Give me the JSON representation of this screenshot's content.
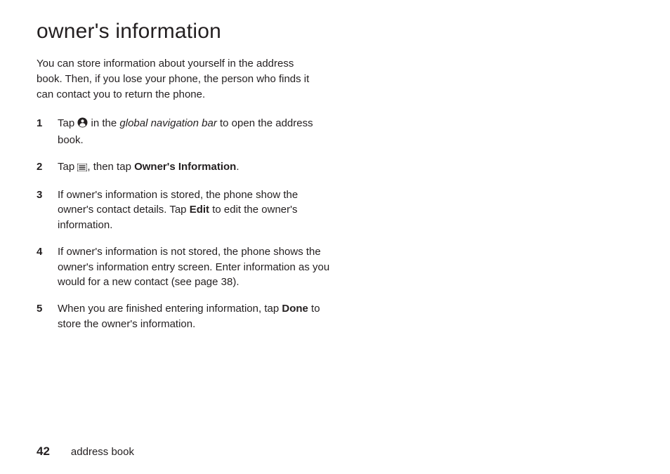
{
  "title": "owner's information",
  "intro": "You can store information about yourself in the address book. Then, if you lose your phone, the person who finds it can contact you to return the phone.",
  "steps": [
    {
      "num": "1",
      "pre": "Tap ",
      "icon": "contact-icon",
      "mid": " in the ",
      "italic": "global navigation bar",
      "post": " to open the address book."
    },
    {
      "num": "2",
      "pre": "Tap ",
      "icon": "menu-icon",
      "mid": ", then tap ",
      "bold": "Owner's Information",
      "post": "."
    },
    {
      "num": "3",
      "pre": "If owner's information is stored, the phone show the owner's contact details. Tap ",
      "bold": "Edit",
      "post": " to edit the owner's information."
    },
    {
      "num": "4",
      "pre": "If owner's information is not stored, the phone shows the owner's information entry screen. Enter information as you would for a new contact (see page 38)."
    },
    {
      "num": "5",
      "pre": "When you are finished entering information, tap ",
      "bold": "Done",
      "post": " to store the owner's information."
    }
  ],
  "footer": {
    "page_number": "42",
    "section": "address book"
  },
  "icons": {
    "contact-icon": "contact-icon",
    "menu-icon": "menu-icon"
  }
}
